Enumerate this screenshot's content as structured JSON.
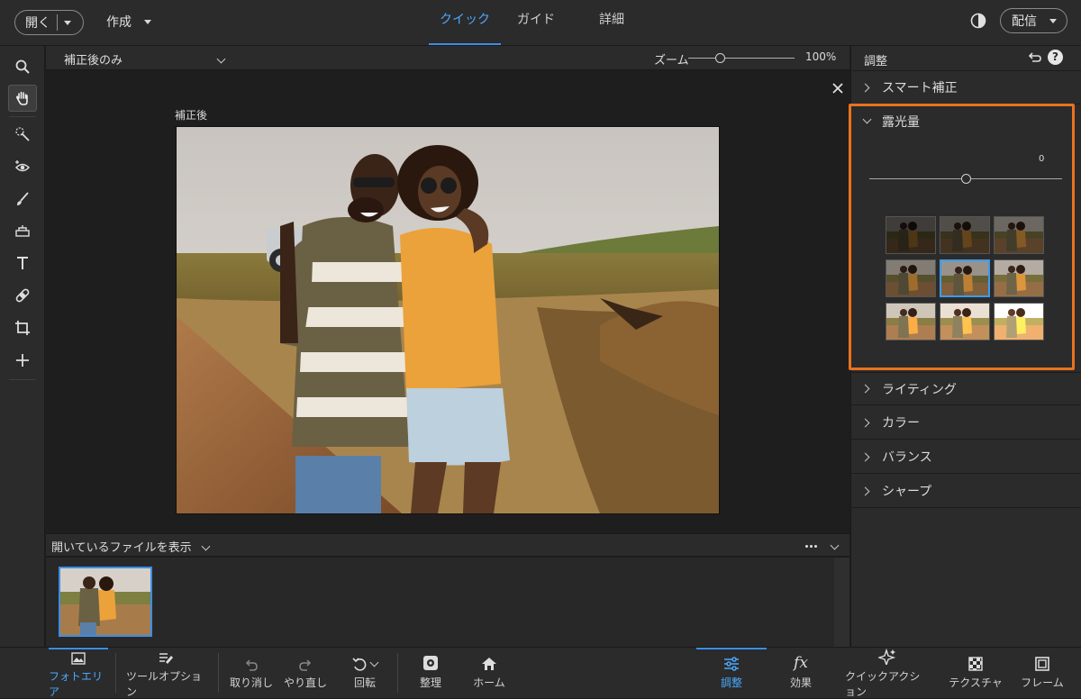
{
  "topbar": {
    "open_label": "開く",
    "create_label": "作成",
    "modes": [
      {
        "label": "クイック",
        "active": true
      },
      {
        "label": "ガイド",
        "active": false
      },
      {
        "label": "詳細",
        "active": false
      }
    ],
    "share_label": "配信"
  },
  "viewbar": {
    "view_select": "補正後のみ",
    "zoom_label": "ズーム",
    "zoom_value": "100%",
    "zoom_fraction": 0.3
  },
  "canvas": {
    "image_caption": "補正後"
  },
  "bin": {
    "selector_label": "開いているファイルを表示"
  },
  "adjust_panel": {
    "title": "調整",
    "sections": [
      {
        "label": "スマート補正",
        "expanded": false
      },
      {
        "label": "露光量",
        "expanded": true
      },
      {
        "label": "ライティング",
        "expanded": false
      },
      {
        "label": "カラー",
        "expanded": false
      },
      {
        "label": "バランス",
        "expanded": false
      },
      {
        "label": "シャープ",
        "expanded": false
      }
    ],
    "exposure_value": "0",
    "exposure_slider_fraction": 0.5,
    "presets_grid": {
      "rows": 3,
      "cols": 3,
      "selected_index": 4
    },
    "highlight_color": "#e8731e"
  },
  "bottombar": {
    "items": [
      {
        "label": "フォトエリア",
        "icon": "photo-bin-icon",
        "active": true
      },
      {
        "label": "ツールオプション",
        "icon": "tool-options-icon",
        "active": false
      },
      {
        "label": "取り消し",
        "icon": "undo-icon",
        "active": false
      },
      {
        "label": "やり直し",
        "icon": "redo-icon",
        "active": false
      },
      {
        "label": "回転",
        "icon": "rotate-icon",
        "active": false
      },
      {
        "label": "整理",
        "icon": "organize-icon",
        "active": false
      },
      {
        "label": "ホーム",
        "icon": "home-icon",
        "active": false
      },
      {
        "label": "調整",
        "icon": "adjustments-icon",
        "active": true
      },
      {
        "label": "効果",
        "icon": "fx-icon",
        "active": false
      },
      {
        "label": "クイックアクション",
        "icon": "sparkle-icon",
        "active": false
      },
      {
        "label": "テクスチャ",
        "icon": "texture-icon",
        "active": false
      },
      {
        "label": "フレーム",
        "icon": "frame-icon",
        "active": false
      }
    ]
  },
  "colors": {
    "accent": "#3a8ee6",
    "accent_text": "#4aa8ff",
    "panel_bg": "#2b2b2b",
    "app_bg": "#1e1e1e"
  }
}
